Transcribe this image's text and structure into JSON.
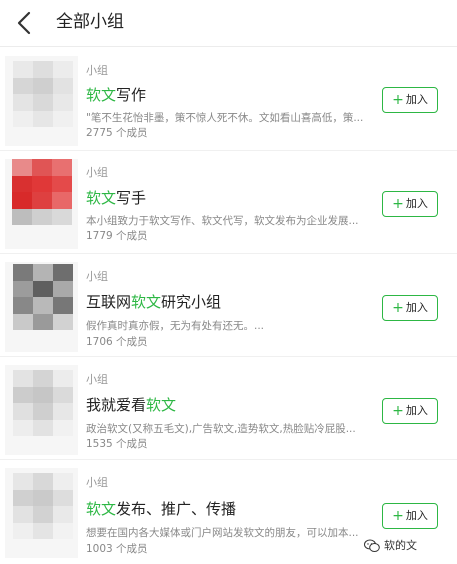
{
  "header": {
    "title": "全部小组"
  },
  "groups": [
    {
      "category": "小组",
      "name_hl": "软文",
      "name_rest": "写作",
      "name_prefix": "",
      "desc": "\"笔不生花怡非墨，策不惊人死不休。文如看山喜高低，策...",
      "members": "2775 个成员",
      "join_label": "加入"
    },
    {
      "category": "小组",
      "name_hl": "软文",
      "name_rest": "写手",
      "name_prefix": "",
      "desc": "本小组致力于软文写作、软文代写，软文发布为企业发展...",
      "members": "1779 个成员",
      "join_label": "加入"
    },
    {
      "category": "小组",
      "name_prefix": "互联网",
      "name_hl": "软文",
      "name_rest": "研究小组",
      "desc": "假作真时真亦假，无为有处有还无。...",
      "members": "1706 个成员",
      "join_label": "加入"
    },
    {
      "category": "小组",
      "name_prefix": "我就爱看",
      "name_hl": "软文",
      "name_rest": "",
      "desc": "政治软文(又称五毛文),广告软文,造势软文,热脸贴冷屁股...",
      "members": "1535 个成员",
      "join_label": "加入"
    },
    {
      "category": "小组",
      "name_prefix": "",
      "name_hl": "软文",
      "name_rest": "发布、推广、传播",
      "desc": "想要在国内各大媒体或门户网站发软文的朋友，可以加本...",
      "members": "1003 个成员",
      "join_label": "加入"
    }
  ],
  "watermark": {
    "text": "软的文",
    "icon": "wechat-icon"
  },
  "colors": {
    "accent": "#2db744",
    "text": "#222222",
    "muted": "#888888"
  }
}
